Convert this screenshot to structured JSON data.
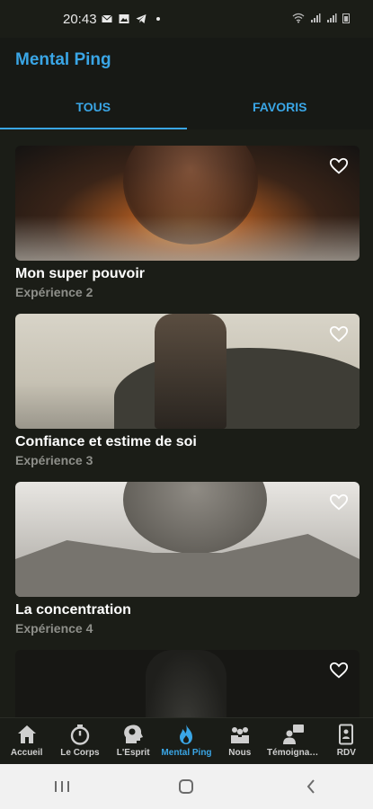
{
  "status_bar": {
    "time": "20:43"
  },
  "app": {
    "title": "Mental Ping"
  },
  "tabs": [
    {
      "label": "TOUS",
      "active": true
    },
    {
      "label": "FAVORIS",
      "active": false
    }
  ],
  "cards": [
    {
      "title": "Mon super pouvoir",
      "subtitle": "Expérience 2"
    },
    {
      "title": "Confiance et estime de soi",
      "subtitle": "Expérience 3"
    },
    {
      "title": "La concentration",
      "subtitle": "Expérience 4"
    },
    {
      "title": "",
      "subtitle": ""
    }
  ],
  "bottom_nav": [
    {
      "label": "Accueil",
      "icon": "home-icon"
    },
    {
      "label": "Le Corps",
      "icon": "stopwatch-icon"
    },
    {
      "label": "L'Esprit",
      "icon": "brain-head-icon"
    },
    {
      "label": "Mental Ping",
      "icon": "flame-icon",
      "active": true
    },
    {
      "label": "Nous",
      "icon": "group-icon"
    },
    {
      "label": "Témoignag...",
      "icon": "testimony-icon"
    },
    {
      "label": "RDV",
      "icon": "appointment-icon"
    }
  ],
  "colors": {
    "accent": "#3aa6e6",
    "background": "#1b1d17",
    "subtitle": "#8e8f8a"
  }
}
